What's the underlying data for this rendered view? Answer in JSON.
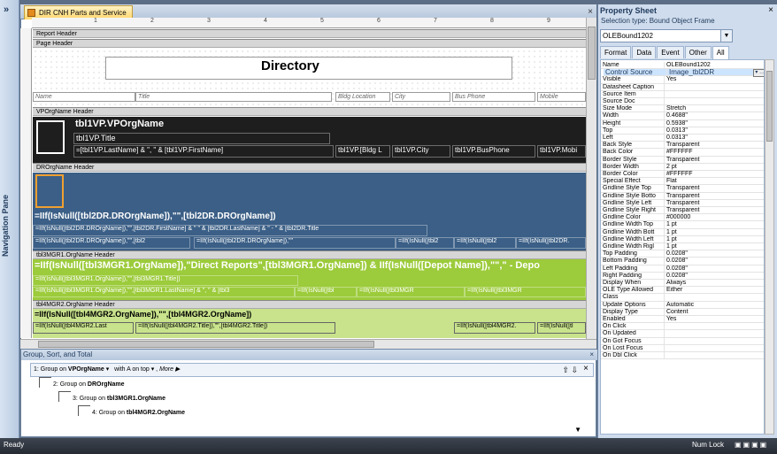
{
  "nav": {
    "label": "Navigation Pane",
    "toggle": "»"
  },
  "doc": {
    "tab": "DIR CNH Parts and Service",
    "close": "×",
    "ruler_marks": [
      "1",
      "2",
      "3",
      "4",
      "5",
      "6",
      "7",
      "8",
      "9"
    ],
    "sections": {
      "report_header": "Report Header",
      "page_header": "Page Header",
      "vp_header": "VPOrgName Header",
      "dr_header": "DROrgName Header",
      "mgr1_header": "tbl3MGR1.OrgName Header",
      "mgr2_header": "tbl4MGR2.OrgName Header"
    },
    "title": "Directory",
    "columns": [
      "Name",
      "Title",
      "Bldg Location",
      "City",
      "Bus Phone",
      "Mobile"
    ],
    "vp": {
      "org": "tbl1VP.VPOrgName",
      "title": "tbl1VP.Title",
      "name": "=[tbl1VP.LastName] & \", \" & [tbl1VP.FirstName]",
      "bldg": "tbl1VP.[Bldg L",
      "city": "tbl1VP.City",
      "phone": "tbl1VP.BusPhone",
      "mobile": "tbl1VP.Mobi"
    },
    "dr": {
      "org": "=IIf(IsNull([tbl2DR.DROrgName]),\"\",[tbl2DR.DROrgName])",
      "row1": "=IIf(IsNull([tbl2DR.DROrgName]),\"\",[tbl2DR.FirstName] & \" \" & [tbl2DR.LastName] & \" - \" & [tbl2DR.Title",
      "row2a": "=IIf(IsNull([tbl2DR.DROrgName]),\"\",[tbl2",
      "row2b": "=IIf(IsNull([tbl2DR.DROrgName]),\"\"",
      "row2c": "=IIf(IsNull([tbl2",
      "row2d": "=IIf(IsNull([tbl2",
      "row2e": "=IIf(IsNull([tbl2DR."
    },
    "mgr1": {
      "org": "=IIf(IsNull([tbl3MGR1.OrgName]),\"Direct Reports\",[tbl3MGR1.OrgName]) & IIf(IsNull([Depot Name]),\"\",\" - Depo",
      "row1": "=IIf(IsNull([tbl3MGR1.OrgName]),\"\",[tbl3MGR1.Title])",
      "row2": "=IIf(IsNull([tbl3MGR1.OrgName]),\"\",[tbl3MGR1.LastName] & \", \" & [tbl3",
      "row2b": "=IIf(IsNull([tbl",
      "=1": "=IIf(IsNull([tbl",
      "row2c": "=IIf(IsNull([tbl3MGR",
      "row2d": "=IIf(IsNull([tbl3MGR"
    },
    "mgr2": {
      "org": "=IIf(IsNull([tbl4MGR2.OrgName]),\"\",[tbl4MGR2.OrgName])",
      "row1a": "=IIf(IsNull([tbl4MGR2.Last",
      "row1b": "=IIf(IsNull([tbl4MGR2.Title]),\"\",[tbl4MGR2.Title])",
      "row1c": "=IIf(IsNull([tbl4MGR2.",
      "row1d": "=IIf(IsNull([tl"
    }
  },
  "group_pane": {
    "title": "Group, Sort, and Total",
    "close": "×",
    "g1": {
      "prefix": "1: Group on ",
      "field": "VPOrgName",
      "order": "with A on top",
      "more": "More ▶"
    },
    "g2": {
      "prefix": "2: Group on ",
      "field": "DROrgName"
    },
    "g3": {
      "prefix": "3: Group on ",
      "field": "tbl3MGR1.OrgName"
    },
    "g4": {
      "prefix": "4: Group on ",
      "field": "tbl4MGR2.OrgName"
    }
  },
  "props": {
    "title": "Property Sheet",
    "close": "×",
    "selection": "Selection type:  Bound Object Frame",
    "object": "OLEBound1202",
    "tabs": [
      "Format",
      "Data",
      "Event",
      "Other",
      "All"
    ],
    "rows": [
      [
        "Name",
        "OLEBound1202"
      ],
      [
        "Control Source",
        "Image_tbl2DR"
      ],
      [
        "Visible",
        "Yes"
      ],
      [
        "Datasheet Caption",
        ""
      ],
      [
        "Source Item",
        ""
      ],
      [
        "Source Doc",
        ""
      ],
      [
        "Size Mode",
        "Stretch"
      ],
      [
        "Width",
        "0.4688\""
      ],
      [
        "Height",
        "0.5938\""
      ],
      [
        "Top",
        "0.0313\""
      ],
      [
        "Left",
        "0.0313\""
      ],
      [
        "Back Style",
        "Transparent"
      ],
      [
        "Back Color",
        "#FFFFFF"
      ],
      [
        "Border Style",
        "Transparent"
      ],
      [
        "Border Width",
        "2 pt"
      ],
      [
        "Border Color",
        "#FFFFFF"
      ],
      [
        "Special Effect",
        "Flat"
      ],
      [
        "Gridline Style Top",
        "Transparent"
      ],
      [
        "Gridline Style Botto",
        "Transparent"
      ],
      [
        "Gridline Style Left",
        "Transparent"
      ],
      [
        "Gridline Style Right",
        "Transparent"
      ],
      [
        "Gridline Color",
        "#000000"
      ],
      [
        "Gridline Width Top",
        "1 pt"
      ],
      [
        "Gridline Width Bott",
        "1 pt"
      ],
      [
        "Gridline Width Left",
        "1 pt"
      ],
      [
        "Gridline Width Rigl",
        "1 pt"
      ],
      [
        "Top Padding",
        "0.0208\""
      ],
      [
        "Bottom Padding",
        "0.0208\""
      ],
      [
        "Left Padding",
        "0.0208\""
      ],
      [
        "Right Padding",
        "0.0208\""
      ],
      [
        "Display When",
        "Always"
      ],
      [
        "OLE Type Allowed",
        "Either"
      ],
      [
        "Class",
        ""
      ],
      [
        "Update Options",
        "Automatic"
      ],
      [
        "Display Type",
        "Content"
      ],
      [
        "Enabled",
        "Yes"
      ],
      [
        "On Click",
        ""
      ],
      [
        "On Updated",
        ""
      ],
      [
        "On Got Focus",
        ""
      ],
      [
        "On Lost Focus",
        ""
      ],
      [
        "On Dbl Click",
        ""
      ]
    ]
  },
  "status": {
    "left": "Ready",
    "numlock": "Num Lock"
  }
}
